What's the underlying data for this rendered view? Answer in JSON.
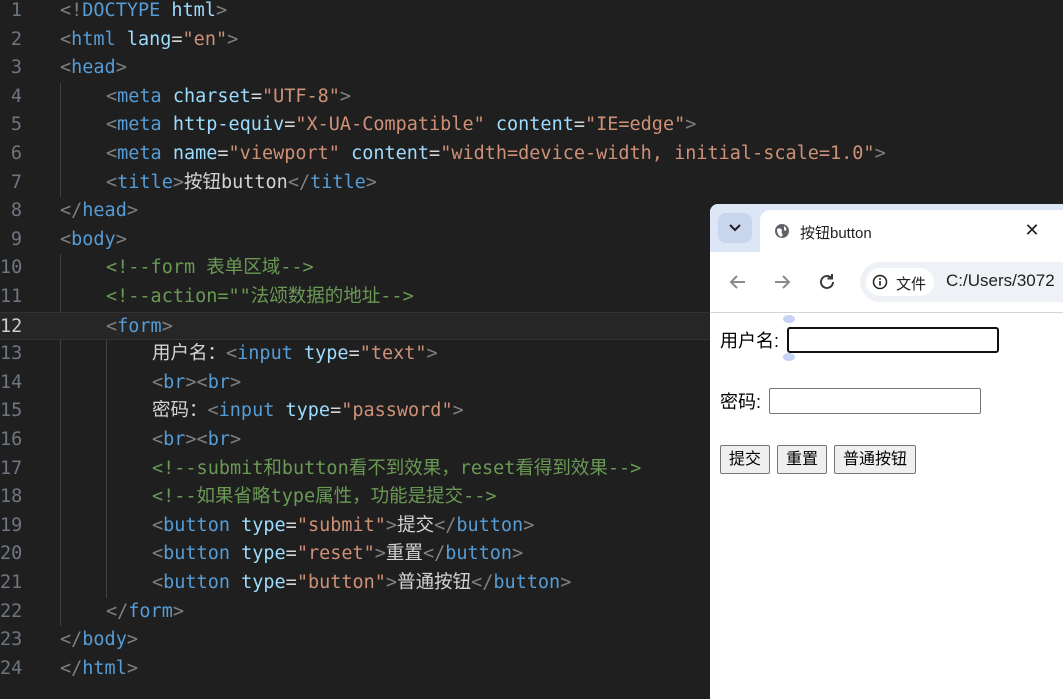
{
  "editor": {
    "active_line": 12,
    "lines": [
      {
        "n": "1",
        "indent": 0,
        "tokens": [
          [
            "t",
            "<!"
          ],
          [
            "n",
            "DOCTYPE"
          ],
          [
            "x",
            " "
          ],
          [
            "a",
            "html"
          ],
          [
            "t",
            ">"
          ]
        ]
      },
      {
        "n": "2",
        "indent": 0,
        "tokens": [
          [
            "t",
            "<"
          ],
          [
            "n",
            "html"
          ],
          [
            "x",
            " "
          ],
          [
            "a",
            "lang"
          ],
          [
            "x",
            "="
          ],
          [
            "v",
            "\"en\""
          ],
          [
            "t",
            ">"
          ]
        ]
      },
      {
        "n": "3",
        "indent": 0,
        "tokens": [
          [
            "t",
            "<"
          ],
          [
            "n",
            "head"
          ],
          [
            "t",
            ">"
          ]
        ]
      },
      {
        "n": "4",
        "indent": 1,
        "tokens": [
          [
            "t",
            "<"
          ],
          [
            "n",
            "meta"
          ],
          [
            "x",
            " "
          ],
          [
            "a",
            "charset"
          ],
          [
            "x",
            "="
          ],
          [
            "v",
            "\"UTF-8\""
          ],
          [
            "t",
            ">"
          ]
        ]
      },
      {
        "n": "5",
        "indent": 1,
        "tokens": [
          [
            "t",
            "<"
          ],
          [
            "n",
            "meta"
          ],
          [
            "x",
            " "
          ],
          [
            "a",
            "http-equiv"
          ],
          [
            "x",
            "="
          ],
          [
            "v",
            "\"X-UA-Compatible\""
          ],
          [
            "x",
            " "
          ],
          [
            "a",
            "content"
          ],
          [
            "x",
            "="
          ],
          [
            "v",
            "\"IE=edge\""
          ],
          [
            "t",
            ">"
          ]
        ]
      },
      {
        "n": "6",
        "indent": 1,
        "tokens": [
          [
            "t",
            "<"
          ],
          [
            "n",
            "meta"
          ],
          [
            "x",
            " "
          ],
          [
            "a",
            "name"
          ],
          [
            "x",
            "="
          ],
          [
            "v",
            "\"viewport\""
          ],
          [
            "x",
            " "
          ],
          [
            "a",
            "content"
          ],
          [
            "x",
            "="
          ],
          [
            "v",
            "\"width=device-width, initial-scale=1.0\""
          ],
          [
            "t",
            ">"
          ]
        ]
      },
      {
        "n": "7",
        "indent": 1,
        "tokens": [
          [
            "t",
            "<"
          ],
          [
            "n",
            "title"
          ],
          [
            "t",
            ">"
          ],
          [
            "x",
            "按钮button"
          ],
          [
            "t",
            "</"
          ],
          [
            "n",
            "title"
          ],
          [
            "t",
            ">"
          ]
        ]
      },
      {
        "n": "8",
        "indent": 0,
        "tokens": [
          [
            "t",
            "</"
          ],
          [
            "n",
            "head"
          ],
          [
            "t",
            ">"
          ]
        ]
      },
      {
        "n": "9",
        "indent": 0,
        "tokens": [
          [
            "t",
            "<"
          ],
          [
            "n",
            "body"
          ],
          [
            "t",
            ">"
          ]
        ]
      },
      {
        "n": "10",
        "indent": 1,
        "tokens": [
          [
            "c",
            "<!--form 表单区域-->"
          ]
        ]
      },
      {
        "n": "11",
        "indent": 1,
        "tokens": [
          [
            "c",
            "<!--action=\"\"法颂数据的地址-->"
          ]
        ]
      },
      {
        "n": "12",
        "indent": 1,
        "tokens": [
          [
            "t",
            "<"
          ],
          [
            "n",
            "form"
          ],
          [
            "t",
            ">"
          ]
        ]
      },
      {
        "n": "13",
        "indent": 2,
        "tokens": [
          [
            "x",
            "用户名："
          ],
          [
            "t",
            "<"
          ],
          [
            "n",
            "input"
          ],
          [
            "x",
            " "
          ],
          [
            "a",
            "type"
          ],
          [
            "x",
            "="
          ],
          [
            "v",
            "\"text\""
          ],
          [
            "t",
            ">"
          ]
        ]
      },
      {
        "n": "14",
        "indent": 2,
        "tokens": [
          [
            "t",
            "<"
          ],
          [
            "n",
            "br"
          ],
          [
            "t",
            "><"
          ],
          [
            "n",
            "br"
          ],
          [
            "t",
            ">"
          ]
        ]
      },
      {
        "n": "15",
        "indent": 2,
        "tokens": [
          [
            "x",
            "密码："
          ],
          [
            "t",
            "<"
          ],
          [
            "n",
            "input"
          ],
          [
            "x",
            " "
          ],
          [
            "a",
            "type"
          ],
          [
            "x",
            "="
          ],
          [
            "v",
            "\"password\""
          ],
          [
            "t",
            ">"
          ]
        ]
      },
      {
        "n": "16",
        "indent": 2,
        "tokens": [
          [
            "t",
            "<"
          ],
          [
            "n",
            "br"
          ],
          [
            "t",
            "><"
          ],
          [
            "n",
            "br"
          ],
          [
            "t",
            ">"
          ]
        ]
      },
      {
        "n": "17",
        "indent": 2,
        "tokens": [
          [
            "c",
            "<!--submit和button看不到效果，reset看得到效果-->"
          ]
        ]
      },
      {
        "n": "18",
        "indent": 2,
        "tokens": [
          [
            "c",
            "<!--如果省略type属性，功能是提交-->"
          ]
        ]
      },
      {
        "n": "19",
        "indent": 2,
        "tokens": [
          [
            "t",
            "<"
          ],
          [
            "n",
            "button"
          ],
          [
            "x",
            " "
          ],
          [
            "a",
            "type"
          ],
          [
            "x",
            "="
          ],
          [
            "v",
            "\"submit\""
          ],
          [
            "t",
            ">"
          ],
          [
            "x",
            "提交"
          ],
          [
            "t",
            "</"
          ],
          [
            "n",
            "button"
          ],
          [
            "t",
            ">"
          ]
        ]
      },
      {
        "n": "20",
        "indent": 2,
        "tokens": [
          [
            "t",
            "<"
          ],
          [
            "n",
            "button"
          ],
          [
            "x",
            " "
          ],
          [
            "a",
            "type"
          ],
          [
            "x",
            "="
          ],
          [
            "v",
            "\"reset\""
          ],
          [
            "t",
            ">"
          ],
          [
            "x",
            "重置"
          ],
          [
            "t",
            "</"
          ],
          [
            "n",
            "button"
          ],
          [
            "t",
            ">"
          ]
        ]
      },
      {
        "n": "21",
        "indent": 2,
        "tokens": [
          [
            "t",
            "<"
          ],
          [
            "n",
            "button"
          ],
          [
            "x",
            " "
          ],
          [
            "a",
            "type"
          ],
          [
            "x",
            "="
          ],
          [
            "v",
            "\"button\""
          ],
          [
            "t",
            ">"
          ],
          [
            "x",
            "普通按钮"
          ],
          [
            "t",
            "</"
          ],
          [
            "n",
            "button"
          ],
          [
            "t",
            ">"
          ]
        ]
      },
      {
        "n": "22",
        "indent": 1,
        "tokens": [
          [
            "t",
            "</"
          ],
          [
            "n",
            "form"
          ],
          [
            "t",
            ">"
          ]
        ]
      },
      {
        "n": "23",
        "indent": 0,
        "tokens": [
          [
            "t",
            "</"
          ],
          [
            "n",
            "body"
          ],
          [
            "t",
            ">"
          ]
        ]
      },
      {
        "n": "24",
        "indent": 0,
        "tokens": [
          [
            "t",
            "</"
          ],
          [
            "n",
            "html"
          ],
          [
            "t",
            ">"
          ]
        ]
      }
    ]
  },
  "browser": {
    "tab_title": "按钮button",
    "close_glyph": "✕",
    "chip_label": "文件",
    "url": "C:/Users/3072",
    "page": {
      "username_label": "用户名:",
      "password_label": "密码:",
      "buttons": [
        "提交",
        "重置",
        "普通按钮"
      ]
    }
  },
  "colors": {
    "editor_bg": "#1f1f1f",
    "tag": "#569cd6",
    "attribute": "#9cdcfe",
    "string": "#ce9178",
    "comment": "#6a9955",
    "tabstrip": "#dde6f6"
  }
}
